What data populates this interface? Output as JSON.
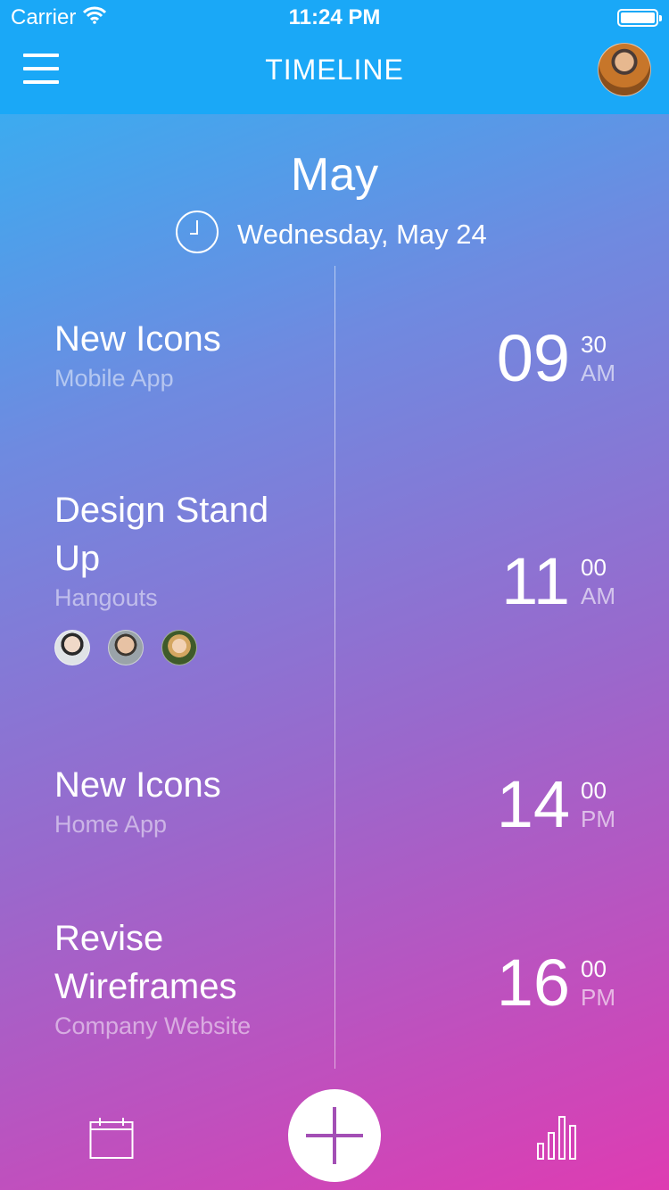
{
  "status_bar": {
    "carrier": "Carrier",
    "time": "11:24 PM"
  },
  "nav": {
    "title": "TIMELINE"
  },
  "header": {
    "month": "May",
    "date": "Wednesday, May 24"
  },
  "events": [
    {
      "title_line1": "New Icons",
      "title_line2": "",
      "subtitle": "Mobile App",
      "hour": "09",
      "minutes": "30",
      "period": "AM"
    },
    {
      "title_line1": "Design Stand",
      "title_line2": "Up",
      "subtitle": "Hangouts",
      "hour": "11",
      "minutes": "00",
      "period": "AM"
    },
    {
      "title_line1": "New Icons",
      "title_line2": "",
      "subtitle": "Home App",
      "hour": "14",
      "minutes": "00",
      "period": "PM"
    },
    {
      "title_line1": "Revise",
      "title_line2": "Wireframes",
      "subtitle": "Company Website",
      "hour": "16",
      "minutes": "00",
      "period": "PM"
    }
  ],
  "colors": {
    "nav_bg": "#1aa8f7",
    "gradient_top": "#2bb6f5",
    "gradient_bottom": "#de3cb2",
    "fab_plus": "#a34fb5"
  },
  "icons": {
    "menu": "hamburger-icon",
    "clock": "clock-icon",
    "calendar": "calendar-icon",
    "add": "plus-icon",
    "stats": "bar-chart-icon"
  }
}
